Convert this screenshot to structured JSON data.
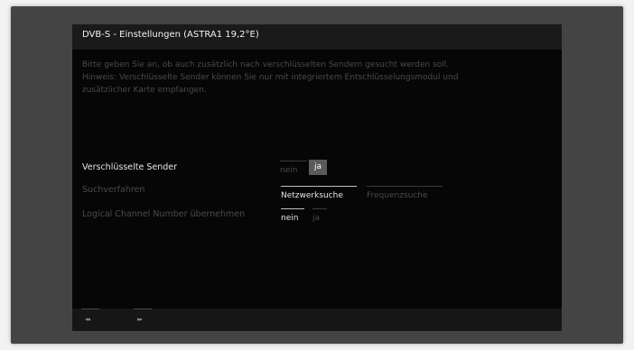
{
  "screen": {
    "title": "DVB-S - Einstellungen (ASTRA1 19,2°E)",
    "info_lines": [
      "Bitte geben Sie an, ob auch zusätzlich nach verschlüsselten Sendern gesucht werden soll.",
      "Hinweis: Verschlüsselte Sender können Sie nur mit integriertem Entschlüsselungsmodul und",
      "zusätzlicher Karte empfangen."
    ]
  },
  "settings": {
    "encrypted": {
      "label": "Verschlüsselte Sender",
      "options": [
        "nein",
        "ja"
      ],
      "selected": "ja"
    },
    "search_method": {
      "label": "Suchverfahren",
      "options": [
        "Netzwerksuche",
        "Frequenzsuche"
      ],
      "selected": "Netzwerksuche"
    },
    "lcn": {
      "label": "Logical Channel Number übernehmen",
      "options": [
        "nein",
        "ja"
      ],
      "selected": "nein"
    }
  },
  "nav": {
    "rewind_icon": "rewind-icon",
    "forward_icon": "fast-forward-icon",
    "rewind_glyph": "◂◂",
    "forward_glyph": "▸▸"
  },
  "colors": {
    "background": "#060606",
    "selected_box": "#5a5a5a",
    "title_bar": "#1a1a1a"
  }
}
